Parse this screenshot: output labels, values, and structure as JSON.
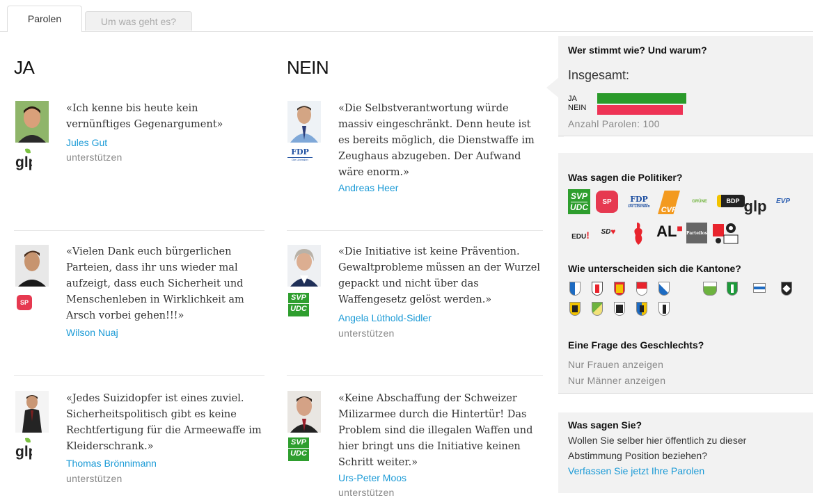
{
  "tabs": [
    "Parolen",
    "Um was geht es?"
  ],
  "columns": {
    "ja": "JA",
    "nein": "NEIN"
  },
  "ja_entries": [
    {
      "quote": "«Ich kenne bis heute kein vernünftiges Gegenargument»",
      "name": "Jules Gut",
      "support": "unterstützen",
      "party": "glp"
    },
    {
      "quote": "«Vielen Dank euch bürgerlichen Parteien, dass ihr uns wieder mal aufzeigt, dass euch Sicherheit und Menschenleben in Wirklichkeit am Arsch vorbei gehen!!!»",
      "name": "Wilson Nuaj",
      "party": "SP"
    },
    {
      "quote": "«Jedes Suizidopfer ist eines zuviel. Sicherheitspolitisch gibt es keine Rechtfertigung für die Armeewaffe im Kleiderschrank.»",
      "name": "Thomas Brönnimann",
      "support": "unterstützen",
      "party": "glp"
    }
  ],
  "nein_entries": [
    {
      "quote": "«Die Selbstverantwortung würde massiv eingeschränkt. Denn heute ist es bereits möglich, die Dienstwaffe im Zeughaus abzugeben. Der Aufwand wäre enorm.»",
      "name": "Andreas Heer",
      "party_main": "FDP",
      "party_sub": "Die Liberalen"
    },
    {
      "quote": "«Die Initiative ist keine Prävention. Gewaltprobleme müssen an der Wurzel gepackt und nicht über das Waffengesetz gelöst werden.»",
      "name": "Angela Lüthold-Sidler",
      "support": "unterstützen",
      "party_top": "SVP",
      "party_bottom": "UDC"
    },
    {
      "quote": "«Keine Abschaffung der Schweizer Milizarmee durch die Hintertür! Das Problem sind die illegalen Waffen und hier bringt uns die Initiative keinen Schritt weiter.»",
      "name": "Urs-Peter Moos",
      "support": "unterstützen",
      "party_top": "SVP",
      "party_bottom": "UDC"
    }
  ],
  "summary": {
    "title": "Wer stimmt wie? Und warum?",
    "overall": "Insgesamt:",
    "ja_label": "JA",
    "nein_label": "NEIN",
    "ja_share": 0.51,
    "nein_share": 0.49,
    "ja_color": "#2a9a2a",
    "nein_color": "#ee3355",
    "count": "Anzahl Parolen: 100"
  },
  "politicians": {
    "title": "Was sagen die Politiker?",
    "logos": [
      "SVP",
      "UDC",
      "SP",
      "FDP",
      "Die Liberalen",
      "CVP",
      "GRÜNE",
      "BDP",
      "glp",
      "EVP",
      "EDU",
      "SD",
      "AL",
      "Parteilos"
    ]
  },
  "cantons": {
    "title": "Wie unterscheiden sich die Kantone?",
    "icons": [
      "uri-icon",
      "schaffhausen-icon",
      "bern-icon",
      "solothurn-icon",
      "luzern-icon",
      "thurgau-icon",
      "st-gallen-icon",
      "zug-icon",
      "appenzell-icon",
      "glarus-icon",
      "aargau-icon",
      "schwyz-icon",
      "obwalden-icon",
      "basel-icon"
    ]
  },
  "gender": {
    "title": "Eine Frage des Geschlechts?",
    "women": "Nur Frauen anzeigen",
    "men": "Nur Männer anzeigen"
  },
  "yours": {
    "title": "Was sagen Sie?",
    "text1": "Wollen Sie selber hier öffentlich zu dieser",
    "text2": "Abstimmung Position beziehen?",
    "link": "Verfassen Sie jetzt Ihre Parolen"
  },
  "colors": {
    "link": "#1a9ad6",
    "svp_green": "#2e9e2e",
    "sp_red": "#e63950",
    "fdp_blue": "#1e4fa0"
  }
}
